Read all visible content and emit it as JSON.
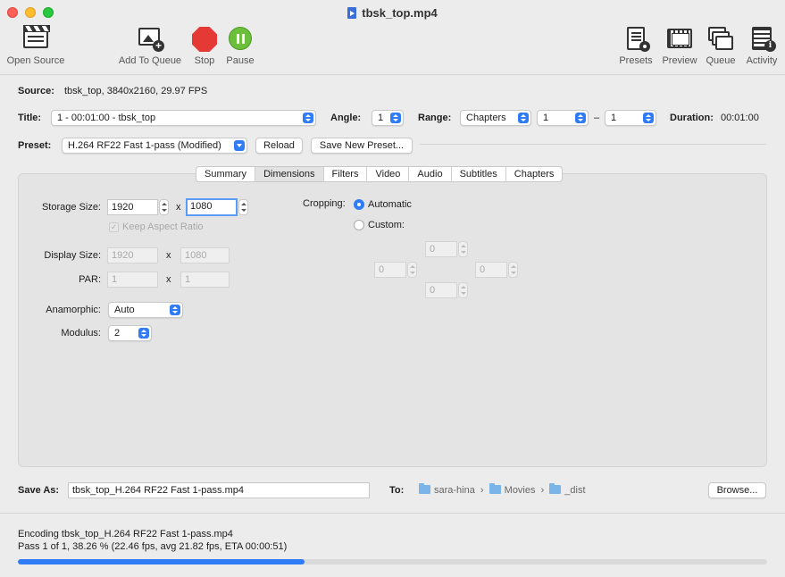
{
  "window": {
    "title": "tbsk_top.mp4"
  },
  "toolbar": {
    "open_source": "Open Source",
    "add_to_queue": "Add To Queue",
    "stop": "Stop",
    "pause": "Pause",
    "presets": "Presets",
    "preview": "Preview",
    "queue": "Queue",
    "activity": "Activity"
  },
  "source": {
    "label": "Source:",
    "value": "tbsk_top, 3840x2160, 29.97 FPS"
  },
  "title_row": {
    "title_label": "Title:",
    "title_value": "1 - 00:01:00 - tbsk_top",
    "angle_label": "Angle:",
    "angle_value": "1",
    "range_label": "Range:",
    "range_type": "Chapters",
    "range_start": "1",
    "range_dash": "–",
    "range_end": "1",
    "duration_label": "Duration:",
    "duration_value": "00:01:00"
  },
  "preset_row": {
    "label": "Preset:",
    "value": "H.264 RF22 Fast 1-pass (Modified)",
    "reload": "Reload",
    "save_new": "Save New Preset..."
  },
  "tabs": [
    "Summary",
    "Dimensions",
    "Filters",
    "Video",
    "Audio",
    "Subtitles",
    "Chapters"
  ],
  "active_tab": "Dimensions",
  "dimensions": {
    "storage_label": "Storage Size:",
    "storage_w": "1920",
    "storage_h": "1080",
    "x": "x",
    "keep_aspect": "Keep Aspect Ratio",
    "display_label": "Display Size:",
    "display_w": "1920",
    "display_h": "1080",
    "par_label": "PAR:",
    "par_w": "1",
    "par_h": "1",
    "anamorphic_label": "Anamorphic:",
    "anamorphic_value": "Auto",
    "modulus_label": "Modulus:",
    "modulus_value": "2",
    "cropping_label": "Cropping:",
    "crop_automatic": "Automatic",
    "crop_custom": "Custom:",
    "crop_top": "0",
    "crop_left": "0",
    "crop_right": "0",
    "crop_bottom": "0"
  },
  "save": {
    "label": "Save As:",
    "filename": "tbsk_top_H.264 RF22 Fast 1-pass.mp4",
    "to_label": "To:",
    "path": [
      "sara-hina",
      "Movies",
      "_dist"
    ],
    "separator": "›",
    "browse": "Browse..."
  },
  "status": {
    "line1": "Encoding tbsk_top_H.264 RF22 Fast 1-pass.mp4",
    "line2": "Pass 1 of 1, 38.26 % (22.46 fps, avg 21.82 fps, ETA 00:00:51)",
    "progress_percent": 38.26
  },
  "colors": {
    "accent": "#2f7cf6",
    "stop": "#e53935",
    "pause": "#6bbf3a"
  }
}
